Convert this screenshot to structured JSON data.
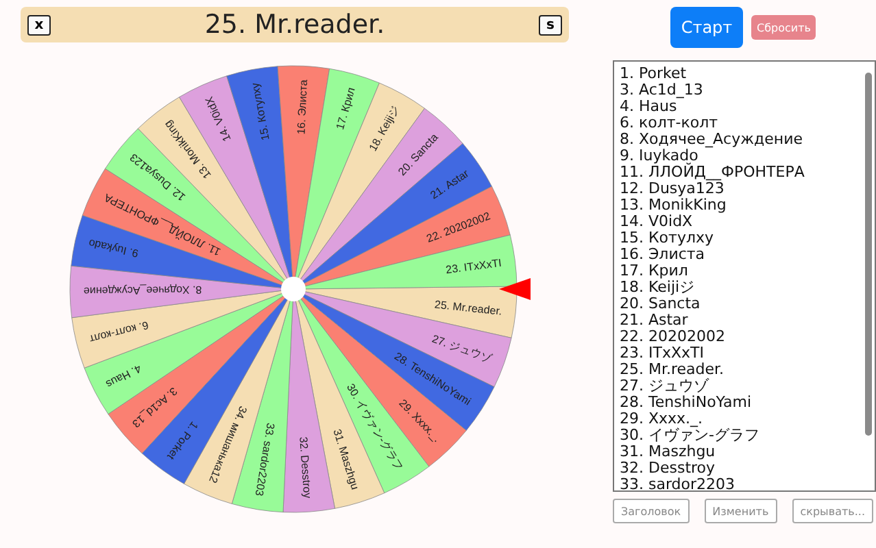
{
  "header": {
    "close_key": "x",
    "title": "25. Mr.reader.",
    "s_key": "s"
  },
  "buttons": {
    "start": "Старт",
    "reset": "Сбросить"
  },
  "wheel": {
    "segments": [
      "25. Mr.reader.",
      "27. ジュウゾ",
      "28. TenshiNoYami",
      "29. Xxxx._.",
      "30. イヴァン-グラフ",
      "31. Maszhgu",
      "32. Desstroy",
      "33. sardor2203",
      "34. мишанька12",
      "1. Porket",
      "3. Ac1d_13",
      "4. Haus",
      "6. колт-колт",
      "8. Ходячее_Асуждение",
      "9. Iuykado",
      "11. ЛЛОЙД__ФРОНТЕРА",
      "12. Dusya123",
      "13. MonikKing",
      "14. V0idX",
      "15. Котулху",
      "16. Элиста",
      "17. Крил",
      "18. Keijiジ",
      "20. Sancta",
      "21. Astar",
      "22. 20202002",
      "23. ITxXxTI"
    ]
  },
  "list": [
    "1. Porket",
    "3. Ac1d_13",
    "4. Haus",
    "6. колт-колт",
    "8. Ходячее_Асуждение",
    "9. Iuykado",
    "11. ЛЛОЙД__ФРОНТЕРА",
    "12. Dusya123",
    "13. MonikKing",
    "14. V0idX",
    "15. Котулху",
    "16. Элиста",
    "17. Крил",
    "18. Keijiジ",
    "20. Sancta",
    "21. Astar",
    "22. 20202002",
    "23. ITxXxTI",
    "25. Mr.reader.",
    "27. ジュウゾ",
    "28. TenshiNoYami",
    "29. Xxxx._.",
    "30. イヴァン-グラフ",
    "31. Maszhgu",
    "32. Desstroy",
    "33. sardor2203"
  ],
  "bottom_buttons": [
    "Заголовок",
    "Изменить",
    "скрывать..."
  ]
}
